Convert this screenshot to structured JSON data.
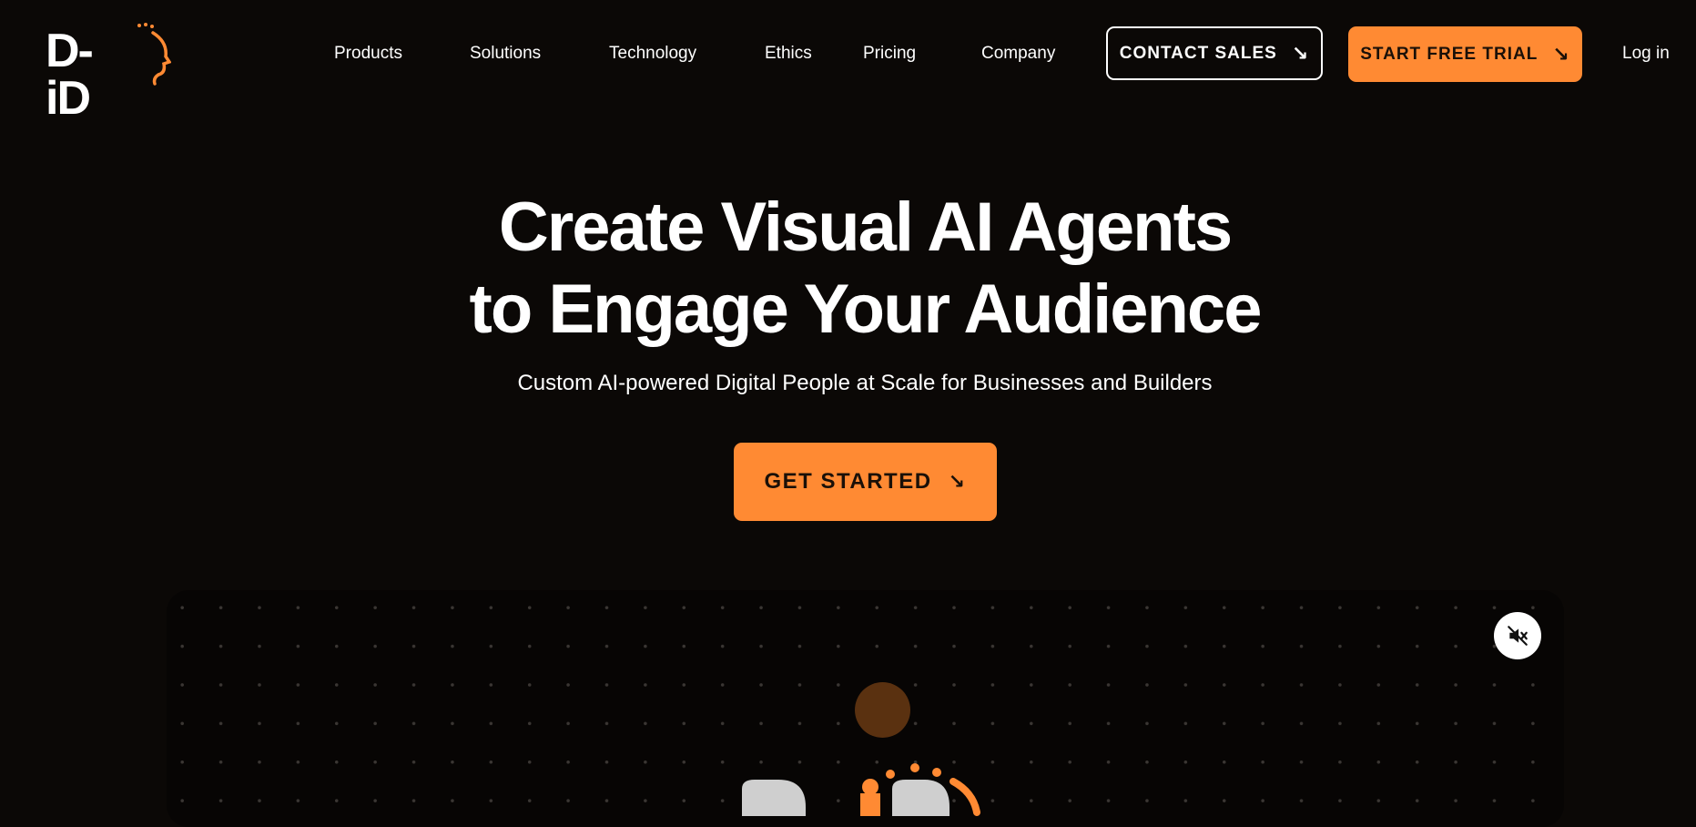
{
  "brand": {
    "logo_text": "D-iD",
    "accent_color": "#ff8a33",
    "background_color": "#0b0806"
  },
  "nav": {
    "items": [
      {
        "label": "Products"
      },
      {
        "label": "Solutions"
      },
      {
        "label": "Technology"
      },
      {
        "label": "Ethics"
      },
      {
        "label": "Pricing"
      },
      {
        "label": "Company"
      }
    ],
    "contact_sales_label": "CONTACT SALES",
    "start_trial_label": "START FREE TRIAL",
    "login_label": "Log in",
    "arrow_icon": "arrow-down-right-icon"
  },
  "hero": {
    "title_line1": "Create Visual AI Agents",
    "title_line2": "to Engage Your Audience",
    "subtitle": "Custom AI-powered Digital People at Scale for Businesses and Builders",
    "cta_label": "GET STARTED"
  },
  "media": {
    "mute_icon": "speaker-muted-icon"
  }
}
